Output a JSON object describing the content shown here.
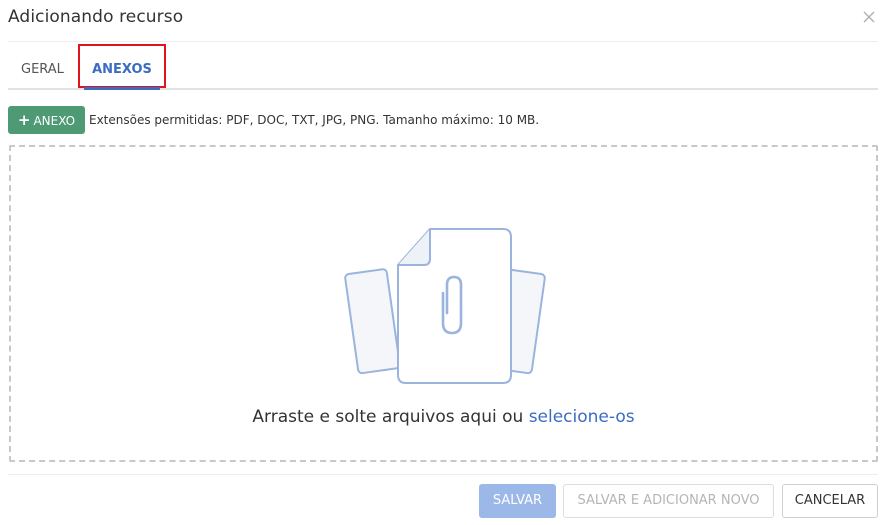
{
  "dialog": {
    "title": "Adicionando recurso",
    "close_icon": "close-icon"
  },
  "tabs": [
    {
      "label": "GERAL",
      "active": false
    },
    {
      "label": "ANEXOS",
      "active": true
    }
  ],
  "toolbar": {
    "add_button_label": "ANEXO",
    "add_button_icon": "plus-icon",
    "extensions_info": "Extensões permitidas: PDF, DOC, TXT, JPG, PNG. Tamanho máximo: 10 MB."
  },
  "dropzone": {
    "text": "Arraste e solte arquivos aqui ou",
    "link_text": "selecione-os",
    "illustration_icon": "paperclip-documents-icon"
  },
  "footer": {
    "save_label": "SALVAR",
    "save_and_new_label": "SALVAR E ADICIONAR NOVO",
    "cancel_label": "CANCELAR"
  },
  "colors": {
    "accent": "#3a6cc2",
    "add_button": "#4e9a74",
    "save_disabled": "#9bb8e8",
    "highlight_border": "#e0141e"
  }
}
